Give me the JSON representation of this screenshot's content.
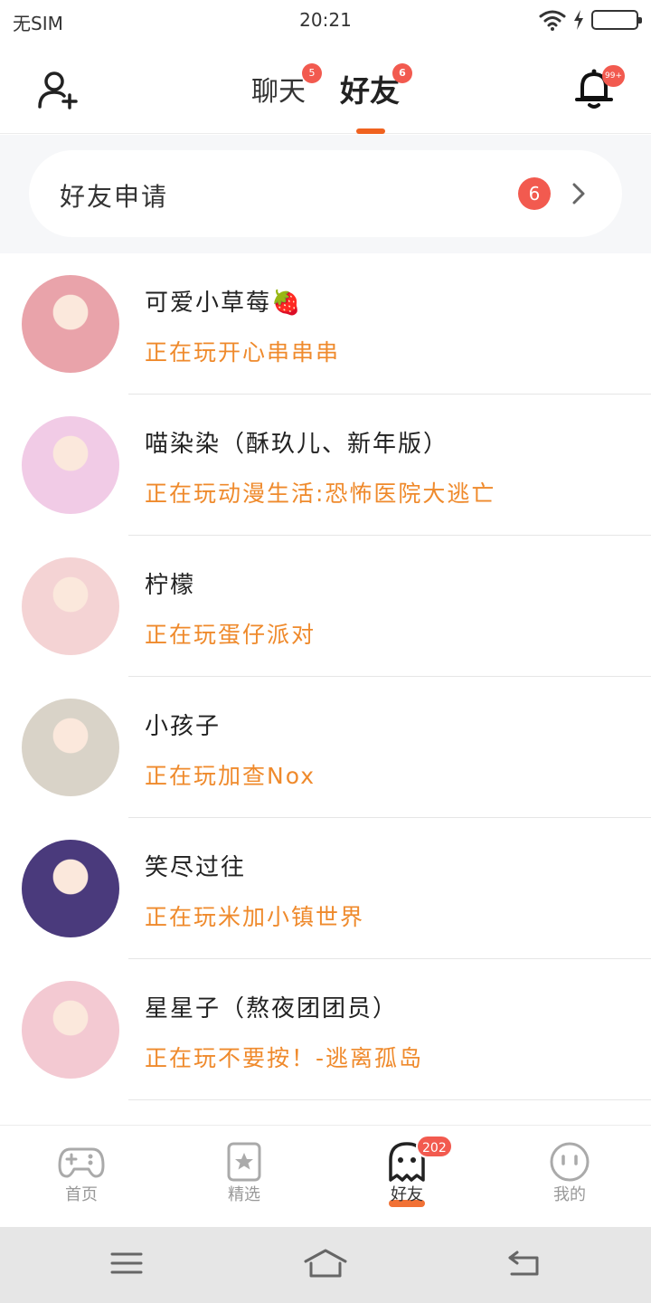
{
  "status_bar": {
    "carrier": "无SIM",
    "time": "20:21"
  },
  "header": {
    "tabs": [
      {
        "label": "聊天",
        "badge": "5"
      },
      {
        "label": "好友",
        "badge": "6"
      }
    ],
    "bell_badge": "99+"
  },
  "friend_request": {
    "label": "好友申请",
    "count": "6"
  },
  "friends": [
    {
      "name": "可爱小草莓🍓",
      "status": "正在玩开心串串串",
      "avatar_color": "#e9a3aa"
    },
    {
      "name": "喵染染（酥玖儿、新年版）",
      "status": "正在玩动漫生活:恐怖医院大逃亡",
      "avatar_color": "#f1cbe6"
    },
    {
      "name": "柠檬",
      "status": "正在玩蛋仔派对",
      "avatar_color": "#f4d3d4"
    },
    {
      "name": "小孩子",
      "status": "正在玩加查Nox",
      "avatar_color": "#d9d3c8"
    },
    {
      "name": "笑尽过往",
      "status": "正在玩米加小镇世界",
      "avatar_color": "#4a3a7c"
    },
    {
      "name": "星星子（熬夜团团员）",
      "status": "正在玩不要按！-逃离孤岛",
      "avatar_color": "#f3c9d2"
    }
  ],
  "bottom_nav": [
    {
      "label": "首页",
      "icon": "gamepad-icon"
    },
    {
      "label": "精选",
      "icon": "star-bookmark-icon"
    },
    {
      "label": "好友",
      "icon": "ghost-icon",
      "badge": "202"
    },
    {
      "label": "我的",
      "icon": "face-icon"
    }
  ],
  "colors": {
    "accent": "#f0621f",
    "badge": "#f25a4f",
    "status_text": "#ef8a2c"
  }
}
